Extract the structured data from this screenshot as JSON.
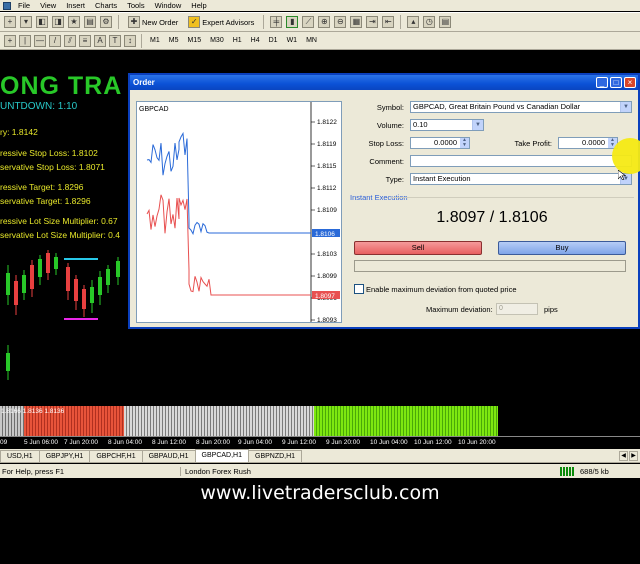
{
  "menubar": {
    "items": [
      "File",
      "View",
      "Insert",
      "Charts",
      "Tools",
      "Window",
      "Help"
    ]
  },
  "toolbar": {
    "new_order": "New Order",
    "expert_advisors": "Expert Advisors",
    "timeframes": [
      "M1",
      "M5",
      "M15",
      "M30",
      "H1",
      "H4",
      "D1",
      "W1",
      "MN"
    ],
    "draw_text": "A"
  },
  "chart": {
    "title_fragment": "ONG TRA",
    "countdown": "UNTDOWN: 1:10",
    "lines": [
      {
        "text": "ry: 1.8142",
        "color": "#e8e82a"
      },
      {
        "text": "ressive Stop Loss: 1.8102",
        "color": "#e8e82a"
      },
      {
        "text": "servative Stop Loss: 1.8071",
        "color": "#e8e82a"
      },
      {
        "text": "ressive Target: 1.8296",
        "color": "#e8e82a"
      },
      {
        "text": "servative Target: 1.8296",
        "color": "#e8e82a"
      },
      {
        "text": "ressive Lot Size Multiplier: 0.67",
        "color": "#e8e82a"
      },
      {
        "text": "servative Lot Size Multiplier: 0.4",
        "color": "#e8e82a"
      }
    ],
    "indicator_label": "1.8166 1.8136 1.8136",
    "time_labels": [
      "09",
      "5 Jun 06:00",
      "7 Jun 20:00",
      "8 Jun 04:00",
      "8 Jun 12:00",
      "8 Jun 20:00",
      "9 Jun 04:00",
      "9 Jun 12:00",
      "9 Jun 20:00",
      "10 Jun 04:00",
      "10 Jun 12:00",
      "10 Jun 20:00"
    ]
  },
  "order": {
    "title": "Order",
    "mini_chart": {
      "symbol": "GBPCAD",
      "price_ticks": [
        "1.8122",
        "1.8119",
        "1.8115",
        "1.8112",
        "1.8109",
        "1.8106",
        "1.8103",
        "1.8099",
        "1.8097",
        "1.8096",
        "1.8093"
      ],
      "ask_tag": "1.8106",
      "bid_tag": "1.8097",
      "colors": {
        "ask": "#2a6ad8",
        "bid": "#e85050"
      }
    },
    "labels": {
      "symbol": "Symbol:",
      "volume": "Volume:",
      "stop_loss": "Stop Loss:",
      "take_profit": "Take Profit:",
      "comment": "Comment:",
      "type": "Type:"
    },
    "values": {
      "symbol": "GBPCAD, Great Britain Pound vs Canadian Dollar",
      "volume": "0.10",
      "stop_loss": "0.0000",
      "take_profit": "0.0000",
      "comment": "",
      "type": "Instant Execution"
    },
    "section_label": "Instant Execution",
    "price": "1.8097 / 1.8106",
    "sell_label": "Sell",
    "buy_label": "Buy",
    "deviation_checkbox": "Enable maximum deviation from quoted price",
    "max_deviation_label": "Maximum deviation:",
    "max_deviation_value": "0",
    "pips_label": "pips"
  },
  "tabs": {
    "items": [
      "USD,H1",
      "GBPJPY,H1",
      "GBPCHF,H1",
      "GBPAUD,H1",
      "GBPCAD,H1",
      "GBPNZD,H1"
    ],
    "active": "GBPCAD,H1"
  },
  "status": {
    "help": "For Help, press F1",
    "profile": "London Forex Rush",
    "traffic": "688/5 kb"
  },
  "footer": {
    "url": "www.livetradersclub.com"
  }
}
